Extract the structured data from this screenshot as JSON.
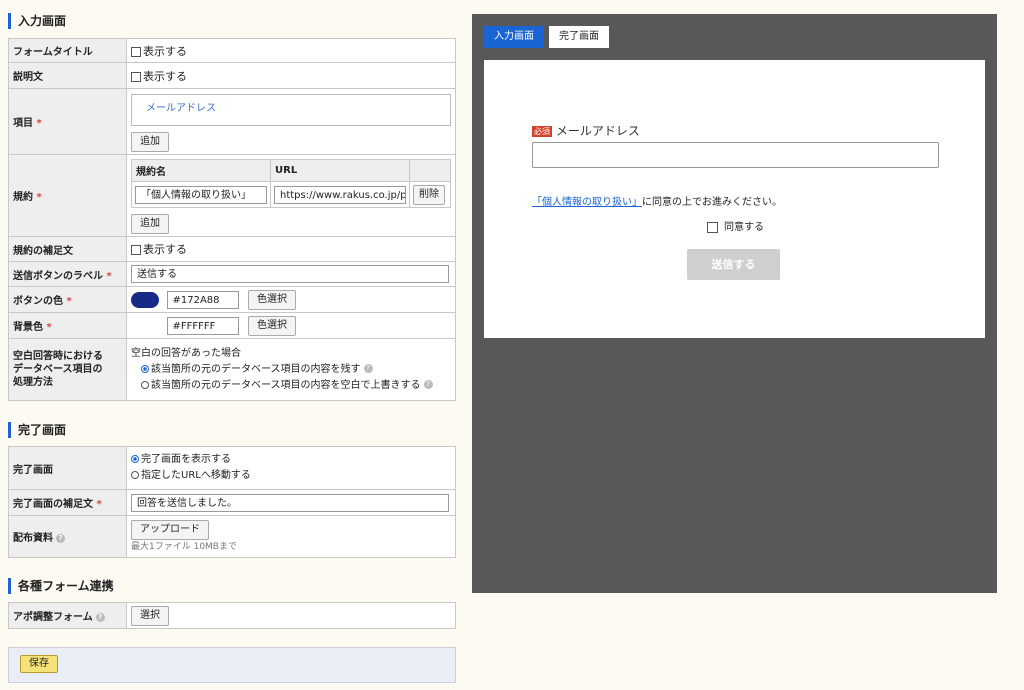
{
  "input_section": {
    "title": "入力画面",
    "form_title": {
      "label": "フォームタイトル",
      "checkbox": "表示する"
    },
    "description": {
      "label": "説明文",
      "checkbox": "表示する"
    },
    "items": {
      "label": "項目",
      "required_mark": "*",
      "list": [
        "メールアドレス"
      ],
      "add_button": "追加"
    },
    "terms": {
      "label": "規約",
      "required_mark": "*",
      "col_name": "規約名",
      "col_url": "URL",
      "rows": [
        {
          "name": "「個人情報の取り扱い」",
          "url": "https://www.rakus.co.jp/p",
          "delete": "削除"
        }
      ],
      "add_button": "追加"
    },
    "terms_note": {
      "label": "規約の補足文",
      "checkbox": "表示する"
    },
    "submit_label": {
      "label": "送信ボタンのラベル",
      "required_mark": "*",
      "value": "送信する"
    },
    "button_color": {
      "label": "ボタンの色",
      "required_mark": "*",
      "value": "#172A88",
      "swatch": "#172a88",
      "pick": "色選択"
    },
    "bg_color": {
      "label": "背景色",
      "required_mark": "*",
      "value": "#FFFFFF",
      "pick": "色選択"
    },
    "blank_handling": {
      "label": "空白回答時における\nデータベース項目の\n処理方法",
      "heading": "空白の回答があった場合",
      "option1": "該当箇所の元のデータベース項目の内容を残す",
      "option2": "該当箇所の元のデータベース項目の内容を空白で上書きする",
      "selected": 1
    }
  },
  "complete_section": {
    "title": "完了画面",
    "complete_screen": {
      "label": "完了画面",
      "option1": "完了画面を表示する",
      "option2": "指定したURLへ移動する",
      "selected": 1
    },
    "complete_note": {
      "label": "完了画面の補足文",
      "required_mark": "*",
      "value": "回答を送信しました。"
    },
    "distribution": {
      "label": "配布資料",
      "upload": "アップロード",
      "hint": "最大1ファイル 10MBまで"
    }
  },
  "integration_section": {
    "title": "各種フォーム連携",
    "appointment": {
      "label": "アポ調整フォーム",
      "select": "選択"
    }
  },
  "save_button": "保存",
  "preview": {
    "tabs": [
      "入力画面",
      "完了画面"
    ],
    "active_tab": 0,
    "required_badge": "必須",
    "field_label": "メールアドレス",
    "terms_link": "「個人情報の取り扱い」",
    "terms_text": "に同意の上でお進みください。",
    "agree": "同意する",
    "submit": "送信する"
  },
  "colors": {
    "accent": "#1a64d6",
    "required": "#e23b3b",
    "preview_bg": "#585858",
    "save_bg": "#f6e27a"
  }
}
